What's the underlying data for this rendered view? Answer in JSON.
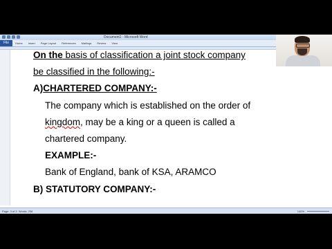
{
  "window": {
    "title": "Document1 - Microsoft Word"
  },
  "ribbon": {
    "file_label": "File",
    "tabs": [
      "Home",
      "Insert",
      "Page Layout",
      "References",
      "Mailings",
      "Review",
      "View"
    ]
  },
  "document": {
    "line1_bold": "On the",
    "line1_rest": " basis of classification a joint stock company",
    "line2": "be classified in the following:-",
    "heading_a_prefix": "A)",
    "heading_a": "CHARTERED COMPANY:-",
    "para1_line1": "The company which is established on the order of",
    "para1_line2_word": "kingdom",
    "para1_line2_rest": ", may be a king or a queen is called a",
    "para1_line3": "chartered company.",
    "example_label": "EXAMPLE:-",
    "example_text": "Bank of England, bank of KSA, ARAMCO",
    "heading_b": "B)  STATUTORY COMPANY:-"
  },
  "statusbar": {
    "page_info": "Page: 3 of 3",
    "words": "Words: 258",
    "zoom": "140%"
  }
}
